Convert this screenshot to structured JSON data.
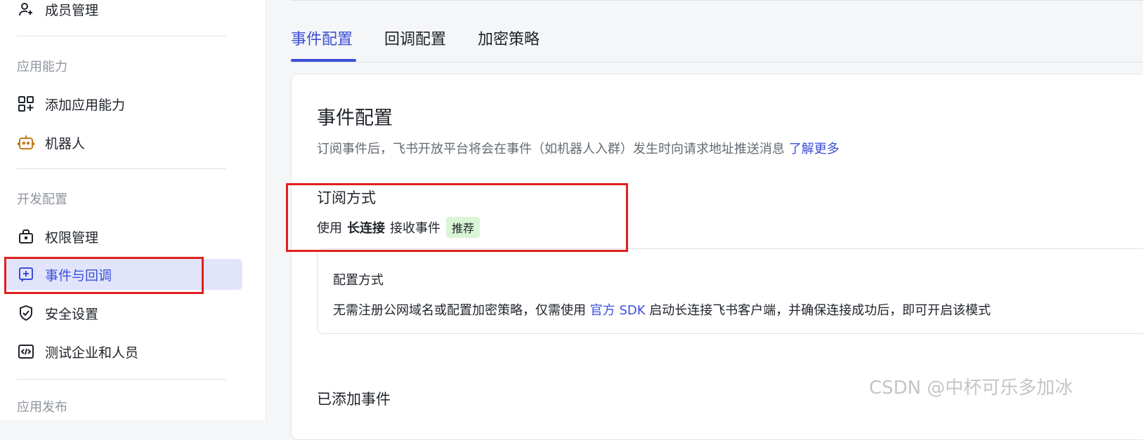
{
  "sidebar": {
    "items": [
      {
        "label": "成员管理",
        "icon": "user-plus-icon"
      },
      {
        "label": "添加应用能力",
        "icon": "grid-plus-icon"
      },
      {
        "label": "机器人",
        "icon": "robot-icon"
      },
      {
        "label": "权限管理",
        "icon": "lock-icon"
      },
      {
        "label": "事件与回调",
        "icon": "event-plus-icon",
        "active": true
      },
      {
        "label": "安全设置",
        "icon": "shield-check-icon"
      },
      {
        "label": "测试企业和人员",
        "icon": "code-icon"
      }
    ],
    "groups": {
      "app_capability": "应用能力",
      "dev_config": "开发配置",
      "app_release": "应用发布"
    }
  },
  "tabs": [
    {
      "label": "事件配置",
      "active": true
    },
    {
      "label": "回调配置"
    },
    {
      "label": "加密策略"
    }
  ],
  "event_config": {
    "title": "事件配置",
    "description": "订阅事件后，飞书开放平台将会在事件（如机器人入群）发生时向请求地址推送消息",
    "learn_more": "了解更多",
    "subscribe_title": "订阅方式",
    "method_prefix": "使用",
    "method_bold": "长连接",
    "method_suffix": "接收事件",
    "recommend_tag": "推荐",
    "config_box": {
      "title": "配置方式",
      "text_before": "无需注册公网域名或配置加密策略，仅需使用",
      "sdk_link": "官方 SDK",
      "text_after": "启动长连接飞书客户端，并确保连接成功后，即可开启该模式"
    },
    "added_events_title": "已添加事件"
  },
  "watermark": "CSDN @中杯可乐多加冰",
  "colors": {
    "accent": "#3b4fd9",
    "active_bg": "#e1e4fb",
    "annotation": "#e02020",
    "tag_bg": "#d9f5d6"
  }
}
